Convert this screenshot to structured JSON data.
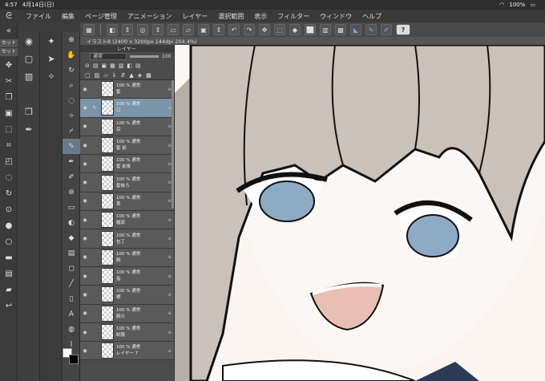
{
  "status": {
    "time": "4:57",
    "date": "4月14日(日)",
    "battery": "100%"
  },
  "menu": {
    "items": [
      "ファイル",
      "編集",
      "ページ管理",
      "アニメーション",
      "レイヤー",
      "選択範囲",
      "表示",
      "フィルター",
      "ウィンドウ",
      "ヘルプ"
    ]
  },
  "canvas_tab": {
    "title": "イラスト8 (2400 x 3200px 144dpi 204.4%)"
  },
  "left_strip": {
    "set_label_1": "セット",
    "set_label_2": "セット"
  },
  "layer_panel": {
    "header": "レイヤー",
    "blend_mode": "通常",
    "opacity": "100",
    "layers": [
      {
        "opacity": "100 % 通常",
        "name": "髪"
      },
      {
        "opacity": "100 % 通常",
        "name": "口",
        "selected": true
      },
      {
        "opacity": "100 % 通常",
        "name": "目"
      },
      {
        "opacity": "100 % 通常",
        "name": "髪 前"
      },
      {
        "opacity": "100 % 通常",
        "name": "髪 前後"
      },
      {
        "opacity": "100 % 通常",
        "name": "髪後ろ"
      },
      {
        "opacity": "100 % 通常",
        "name": "首"
      },
      {
        "opacity": "100 % 通常",
        "name": "輪郭"
      },
      {
        "opacity": "100 % 通常",
        "name": "包丁"
      },
      {
        "opacity": "100 % 通常",
        "name": "腕"
      },
      {
        "opacity": "100 % 通常",
        "name": "指"
      },
      {
        "opacity": "100 % 通常",
        "name": "襟"
      },
      {
        "opacity": "100 % 通常",
        "name": "腕元"
      },
      {
        "opacity": "100 % 通常",
        "name": "制服"
      },
      {
        "opacity": "100 % 通常",
        "name": "レイヤー 7"
      }
    ]
  },
  "colors": {
    "hair": "#c9c0b8",
    "skin": "#fbf5f1",
    "eye": "#8eabc6",
    "mouth": "#e9bfb4",
    "panel": "#4c4c4c",
    "selected_layer": "#7a94a8"
  }
}
